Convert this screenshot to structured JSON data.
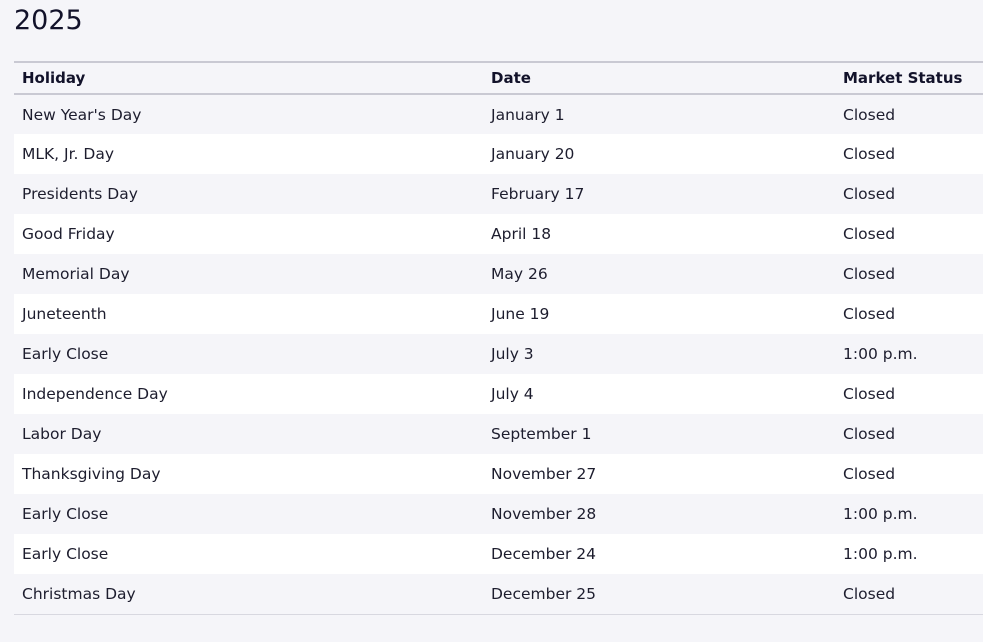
{
  "title": "2025",
  "table": {
    "headers": {
      "holiday": "Holiday",
      "date": "Date",
      "status": "Market Status"
    },
    "rows": [
      {
        "holiday": "New Year's Day",
        "date": "January 1",
        "status": "Closed"
      },
      {
        "holiday": "MLK, Jr. Day",
        "date": "January 20",
        "status": "Closed"
      },
      {
        "holiday": "Presidents Day",
        "date": "February 17",
        "status": "Closed"
      },
      {
        "holiday": "Good Friday",
        "date": "April 18",
        "status": "Closed"
      },
      {
        "holiday": "Memorial Day",
        "date": "May 26",
        "status": "Closed"
      },
      {
        "holiday": "Juneteenth",
        "date": "June 19",
        "status": "Closed"
      },
      {
        "holiday": "Early Close",
        "date": "July 3",
        "status": "1:00 p.m."
      },
      {
        "holiday": "Independence Day",
        "date": "July 4",
        "status": "Closed"
      },
      {
        "holiday": "Labor Day",
        "date": "September 1",
        "status": "Closed"
      },
      {
        "holiday": "Thanksgiving Day",
        "date": "November 27",
        "status": "Closed"
      },
      {
        "holiday": "Early Close",
        "date": "November 28",
        "status": "1:00 p.m."
      },
      {
        "holiday": "Early Close",
        "date": "December 24",
        "status": "1:00 p.m."
      },
      {
        "holiday": "Christmas Day",
        "date": "December 25",
        "status": "Closed"
      }
    ]
  }
}
